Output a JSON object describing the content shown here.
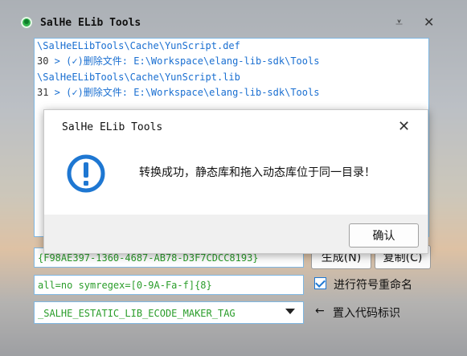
{
  "window": {
    "title": "SalHe ELib Tools",
    "menu_glyph": "⩡",
    "close_glyph": "✕"
  },
  "log": {
    "lines": [
      {
        "num": "",
        "text": "\\SalHeELibTools\\Cache\\YunScript.def"
      },
      {
        "num": "30",
        "text": " > (✓)删除文件: E:\\Workspace\\elang-lib-sdk\\Tools"
      },
      {
        "num": "",
        "text": "\\SalHeELibTools\\Cache\\YunScript.lib"
      },
      {
        "num": "31",
        "text": " > (✓)删除文件: E:\\Workspace\\elang-lib-sdk\\Tools"
      }
    ]
  },
  "guid_field": {
    "value": "{F98AE397-1360-4687-AB78-D3F7CDCC8193}"
  },
  "regex_field": {
    "value": "all=no symregex=[0-9A-Fa-f]{8}"
  },
  "tag_select": {
    "value": "_SALHE_ESTATIC_LIB_ECODE_MAKER_TAG"
  },
  "buttons": {
    "generate": "生成(N)",
    "copy": "复制(C)"
  },
  "rename_option": {
    "label": "进行符号重命名",
    "checked": true
  },
  "insert_tag": {
    "arrow": "←",
    "label": "置入代码标识"
  },
  "dialog": {
    "title": "SalHe ELib Tools",
    "close_glyph": "✕",
    "message": "转换成功，静态库和拖入动态库位于同一目录！",
    "ok": "确认"
  },
  "colors": {
    "accent": "#1e77d2",
    "log_text": "#1a6fd1",
    "field_text": "#2a9d2a"
  }
}
